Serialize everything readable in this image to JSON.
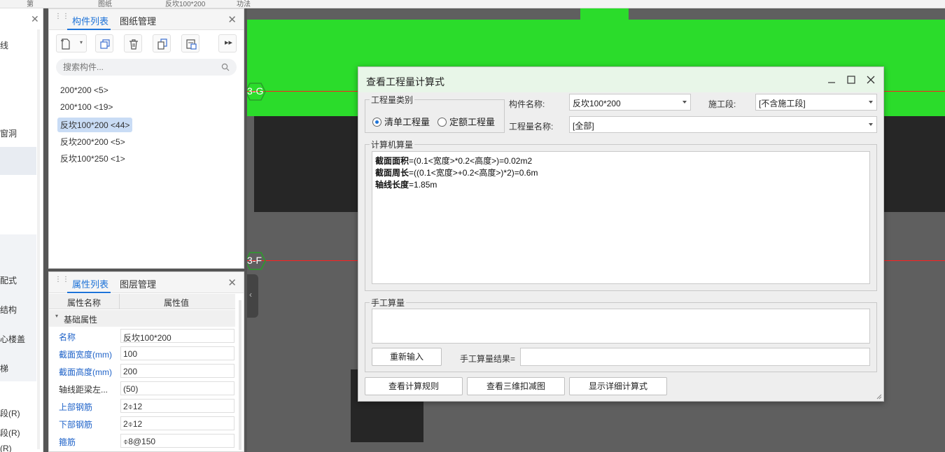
{
  "top_strip": {
    "fragments": [
      "第",
      "图纸",
      "反坎100*200",
      "功法"
    ]
  },
  "left_panel": {
    "items": [
      "线",
      "窗洞",
      "配式",
      "结构",
      "心楼盖",
      "梯",
      "段(R)",
      "段(R)",
      "(R)"
    ]
  },
  "component_panel": {
    "tabs": [
      "构件列表",
      "图纸管理"
    ],
    "search_placeholder": "搜索构件...",
    "items": [
      "200*200 <5>",
      "200*100 <19>",
      "反坎100*200 <44>",
      "反坎200*200 <5>",
      "反坎100*250 <1>"
    ],
    "selected_index": 2
  },
  "property_panel": {
    "tabs": [
      "属性列表",
      "图层管理"
    ],
    "col_name": "属性名称",
    "col_value": "属性值",
    "group": "基础属性",
    "rows": [
      {
        "name": "名称",
        "value": "反坎100*200",
        "blue": true
      },
      {
        "name": "截面宽度(mm)",
        "value": "100",
        "blue": true
      },
      {
        "name": "截面高度(mm)",
        "value": "200",
        "blue": true
      },
      {
        "name": "轴线距梁左...",
        "value": "(50)",
        "blue": false
      },
      {
        "name": "上部钢筋",
        "value": "2⌽12",
        "blue": true
      },
      {
        "name": "下部钢筋",
        "value": "2⌽12",
        "blue": true
      },
      {
        "name": "箍筋",
        "value": "⌽8@150",
        "blue": true
      }
    ]
  },
  "canvas": {
    "axis_labels": [
      "3-G",
      "3-F"
    ],
    "colors": {
      "green": "#2bdc2b",
      "dark": "#262626",
      "gray": "#5f5f5f",
      "axis": "#ff2020"
    }
  },
  "dialog": {
    "title": "查看工程量计算式",
    "qty_type_legend": "工程量类别",
    "radio_list": "清单工程量",
    "radio_quota": "定额工程量",
    "radio_selected": "清单工程量",
    "comp_name_label": "构件名称:",
    "comp_name_value": "反坎100*200",
    "stage_label": "施工段:",
    "stage_value": "[不含施工段]",
    "qty_name_label": "工程量名称:",
    "qty_name_value": "[全部]",
    "machine_legend": "计算机算量",
    "formulas": [
      {
        "label": "截面面积",
        "expr": "=(0.1<宽度>*0.2<高度>)=0.02m2"
      },
      {
        "label": "截面周长",
        "expr": "=((0.1<宽度>+0.2<高度>)*2)=0.6m"
      },
      {
        "label": "轴线长度",
        "expr": "=1.85m"
      }
    ],
    "manual_legend": "手工算量",
    "reinput_button": "重新输入",
    "manual_result_label": "手工算量结果=",
    "btn_rules": "查看计算规则",
    "btn_3d": "查看三维扣减图",
    "btn_detail": "显示详细计算式"
  }
}
